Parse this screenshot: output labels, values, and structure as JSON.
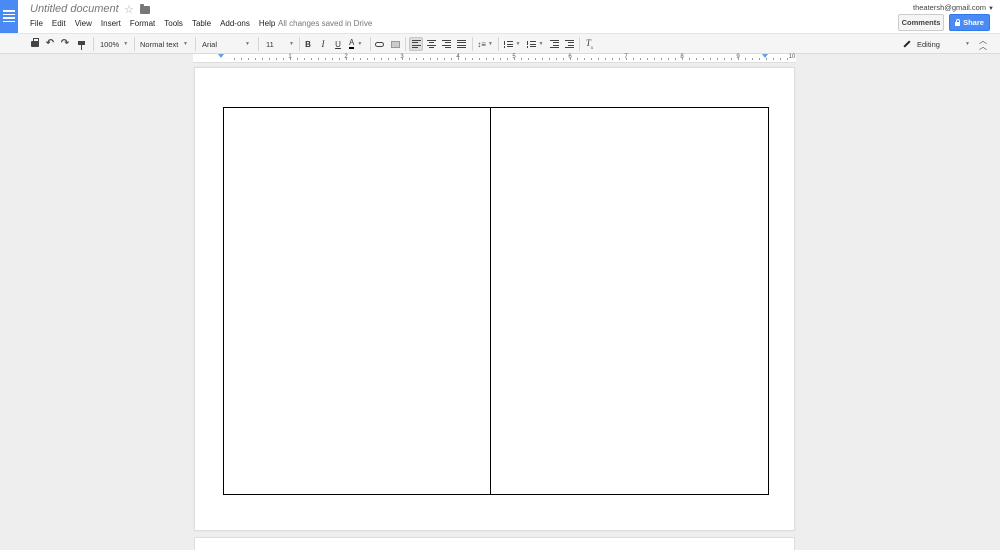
{
  "header": {
    "title": "Untitled document",
    "save_status": "All changes saved in Drive",
    "account": "theatersh@gmail.com",
    "comments_label": "Comments",
    "share_label": "Share"
  },
  "menu": [
    "File",
    "Edit",
    "View",
    "Insert",
    "Format",
    "Tools",
    "Table",
    "Add-ons",
    "Help"
  ],
  "toolbar": {
    "zoom": "100%",
    "style": "Normal text",
    "font": "Arial",
    "font_size": "11",
    "bold": "B",
    "italic": "I",
    "underline": "U",
    "text_color": "A",
    "clear_format": "T",
    "clear_format_sub": "x",
    "mode": "Editing"
  },
  "ruler": {
    "numbers": [
      "1",
      "2",
      "3",
      "4",
      "5",
      "6",
      "7",
      "8",
      "9"
    ],
    "end_number": "10"
  },
  "colors": {
    "brand_blue": "#4a8af4",
    "share_blue": "#4a8af4"
  },
  "table": {
    "rows": 1,
    "cols": 2,
    "cells": [
      "",
      ""
    ]
  }
}
